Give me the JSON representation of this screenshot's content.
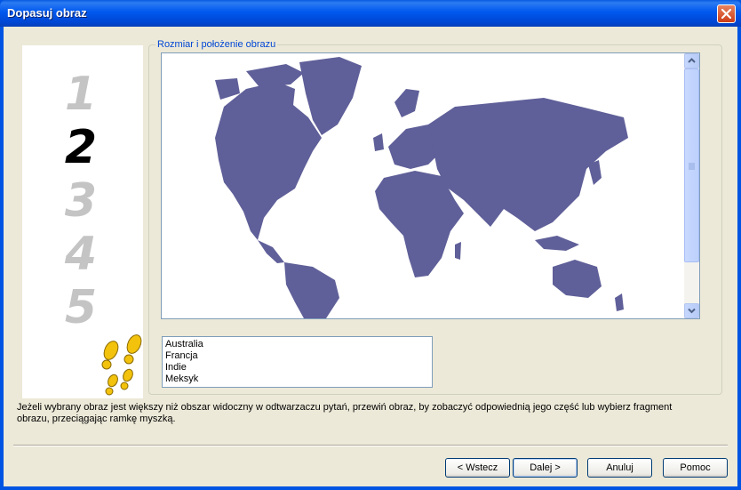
{
  "window": {
    "title": "Dopasuj obraz"
  },
  "steps": {
    "items": [
      "1",
      "2",
      "3",
      "4",
      "5"
    ],
    "active_index": 1,
    "active_color": "#000000",
    "inactive_color": "#c4c4c4"
  },
  "group": {
    "legend": "Rozmiar i położenie obrazu"
  },
  "map": {
    "land_color": "#5f5f99",
    "background": "#ffffff"
  },
  "countries": [
    "Australia",
    "Francja",
    "Indie",
    "Meksyk"
  ],
  "description": "Jeżeli wybrany obraz jest większy niż obszar widoczny w odtwarzaczu pytań, przewiń obraz, by zobaczyć odpowiednią jego część lub wybierz fragment obrazu, przeciągając ramkę myszką.",
  "buttons": {
    "back": "< Wstecz",
    "next": "Dalej >",
    "cancel": "Anuluj",
    "help": "Pomoc"
  },
  "icons": {
    "close": "close-icon",
    "steps": "footprints-icon",
    "scroll_up": "arrow-up-icon",
    "scroll_down": "arrow-down-icon"
  }
}
